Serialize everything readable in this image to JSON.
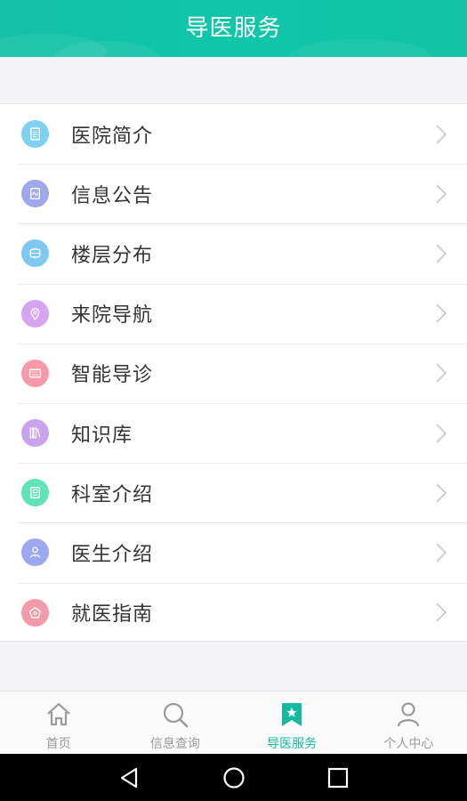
{
  "header": {
    "title": "导医服务"
  },
  "menu": [
    {
      "label": "医院简介",
      "icon": "document-icon",
      "color": "#7ed0f5"
    },
    {
      "label": "信息公告",
      "icon": "notice-icon",
      "color": "#9fa7ee"
    },
    {
      "label": "楼层分布",
      "icon": "building-icon",
      "color": "#7ec9f4"
    },
    {
      "label": "来院导航",
      "icon": "location-icon",
      "color": "#d5a4f2"
    },
    {
      "label": "智能导诊",
      "icon": "keyboard-icon",
      "color": "#f59aa6"
    },
    {
      "label": "知识库",
      "icon": "books-icon",
      "color": "#c9a3f0"
    },
    {
      "label": "科室介绍",
      "icon": "department-icon",
      "color": "#5fe3b8"
    },
    {
      "label": "医生介绍",
      "icon": "doctor-icon",
      "color": "#9ca8ef"
    },
    {
      "label": "就医指南",
      "icon": "guide-icon",
      "color": "#f39aa8"
    }
  ],
  "tabbar": {
    "active_color": "#14bba1",
    "inactive_color": "#9a9a9a",
    "tabs": [
      {
        "label": "首页",
        "icon": "home-icon"
      },
      {
        "label": "信息查询",
        "icon": "search-icon"
      },
      {
        "label": "导医服务",
        "icon": "bookmark-star-icon"
      },
      {
        "label": "个人中心",
        "icon": "person-icon"
      }
    ]
  },
  "navbar": {
    "buttons": [
      "back-icon",
      "home-circle-icon",
      "recents-icon"
    ]
  }
}
